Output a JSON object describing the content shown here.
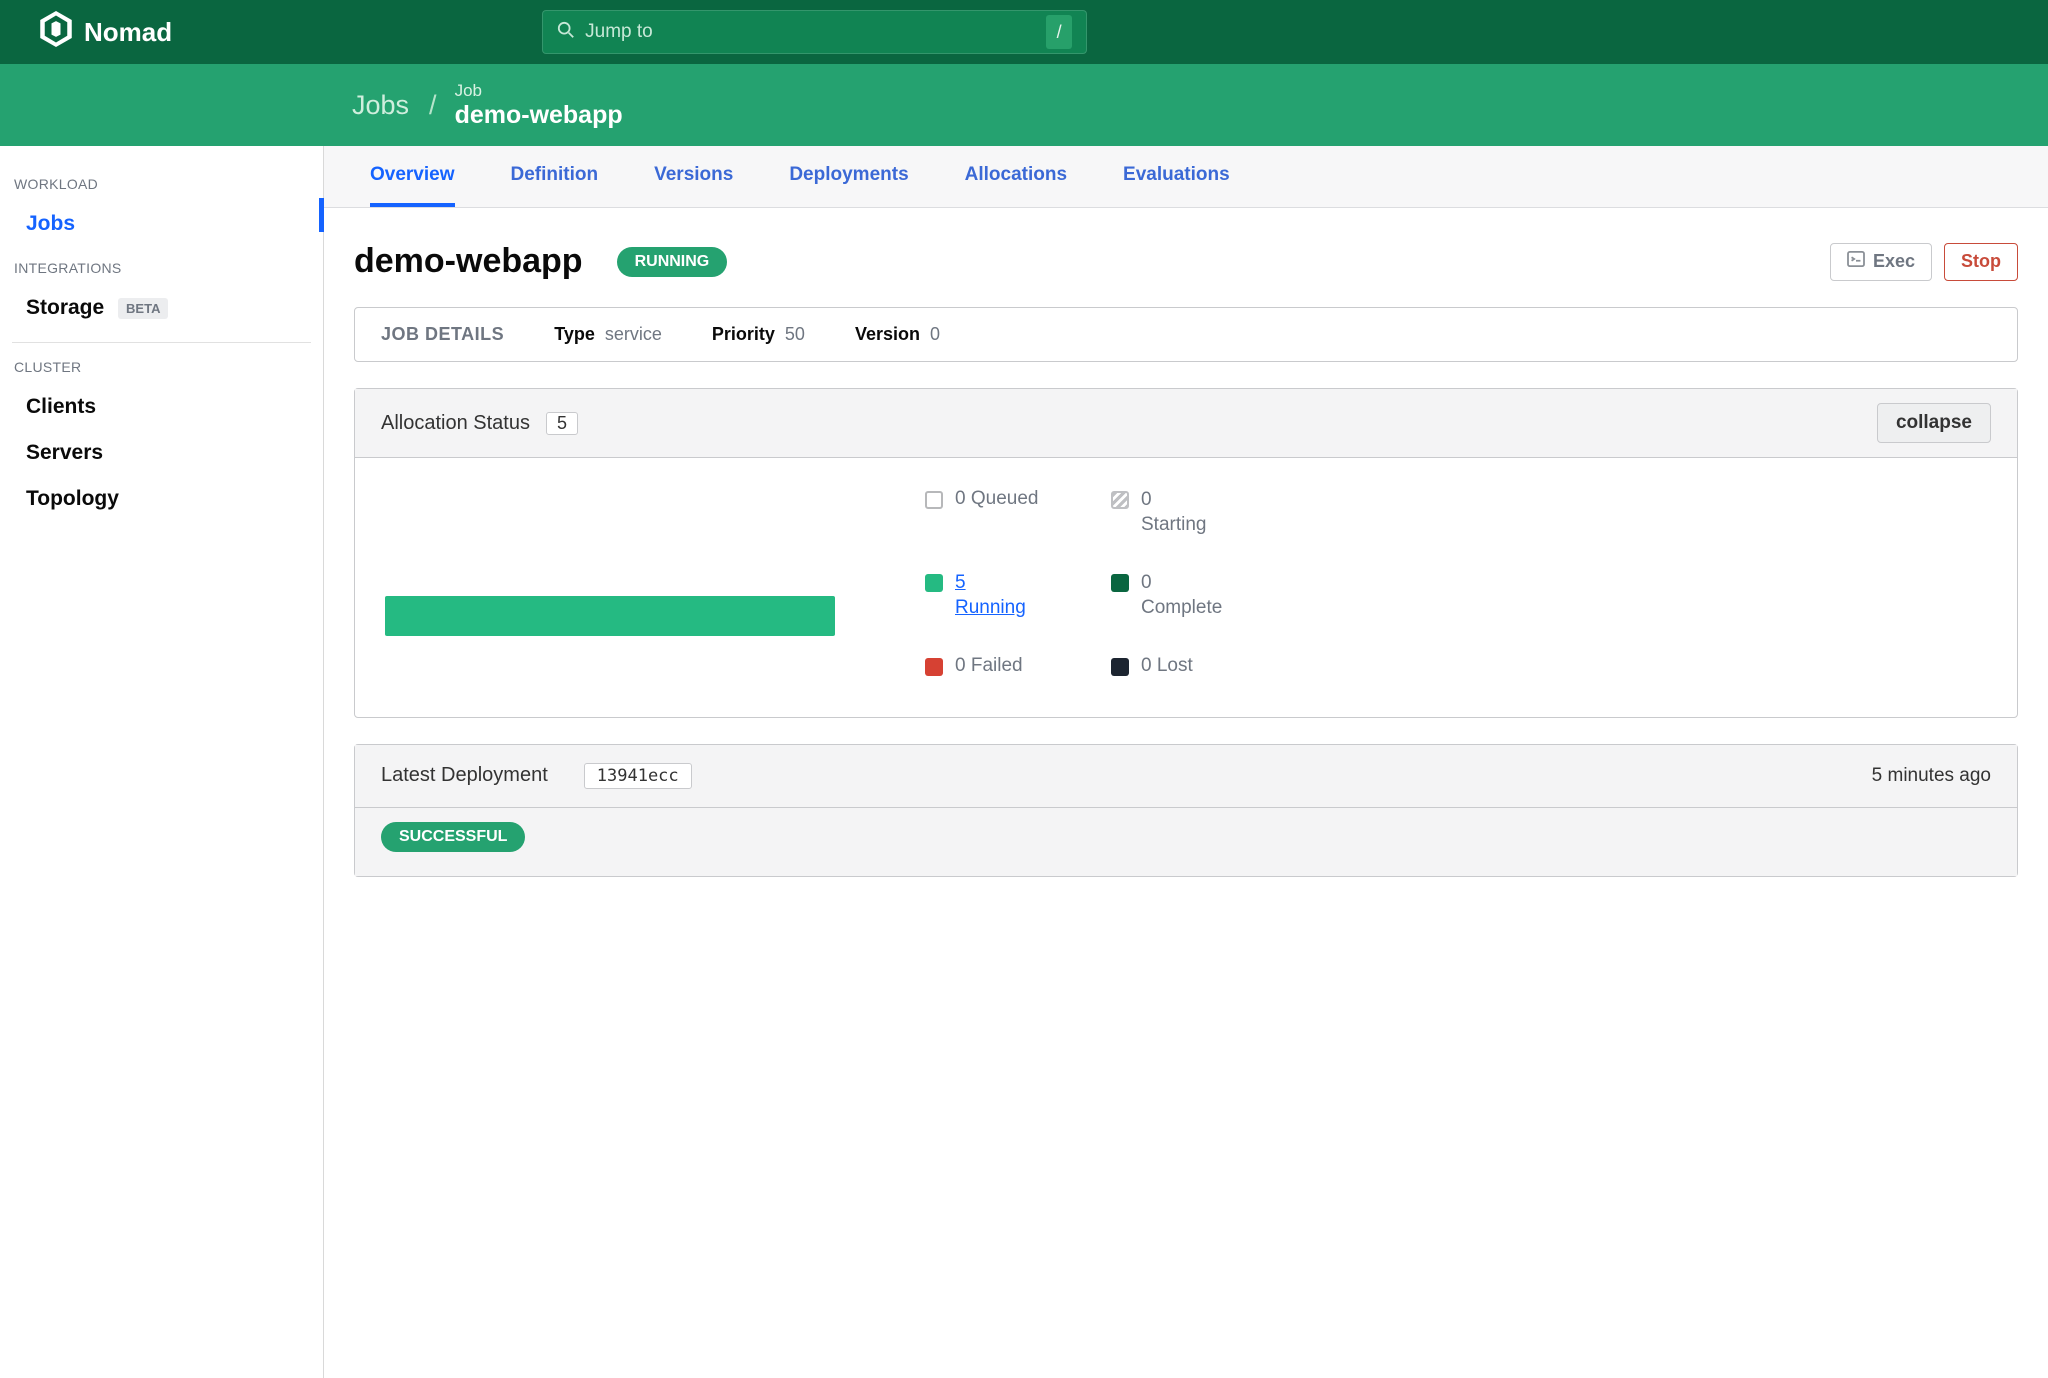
{
  "brand": {
    "name": "Nomad"
  },
  "search": {
    "placeholder": "Jump to",
    "hint": "/"
  },
  "breadcrumb": {
    "root": "Jobs",
    "label": "Job",
    "title": "demo-webapp"
  },
  "sidebar": {
    "sections": [
      {
        "heading": "WORKLOAD",
        "items": [
          {
            "label": "Jobs",
            "active": true
          }
        ]
      },
      {
        "heading": "INTEGRATIONS",
        "items": [
          {
            "label": "Storage",
            "badge": "BETA"
          }
        ]
      },
      {
        "heading": "CLUSTER",
        "items": [
          {
            "label": "Clients"
          },
          {
            "label": "Servers"
          },
          {
            "label": "Topology"
          }
        ]
      }
    ]
  },
  "tabs": [
    "Overview",
    "Definition",
    "Versions",
    "Deployments",
    "Allocations",
    "Evaluations"
  ],
  "active_tab": "Overview",
  "job": {
    "name": "demo-webapp",
    "status": "RUNNING",
    "actions": {
      "exec": "Exec",
      "stop": "Stop"
    },
    "details": {
      "heading": "JOB DETAILS",
      "type_label": "Type",
      "type": "service",
      "priority_label": "Priority",
      "priority": "50",
      "version_label": "Version",
      "version": "0"
    }
  },
  "allocation": {
    "title": "Allocation Status",
    "count": "5",
    "collapse": "collapse",
    "legend": {
      "queued": {
        "count": "0",
        "label": "Queued"
      },
      "starting": {
        "count": "0",
        "label": "Starting"
      },
      "running": {
        "count": "5",
        "label": "Running"
      },
      "complete": {
        "count": "0",
        "label": "Complete"
      },
      "failed": {
        "count": "0",
        "label": "Failed"
      },
      "lost": {
        "count": "0",
        "label": "Lost"
      }
    }
  },
  "deployment": {
    "title": "Latest Deployment",
    "id": "13941ecc",
    "timeago": "5 minutes ago",
    "status": "SUCCESSFUL"
  }
}
